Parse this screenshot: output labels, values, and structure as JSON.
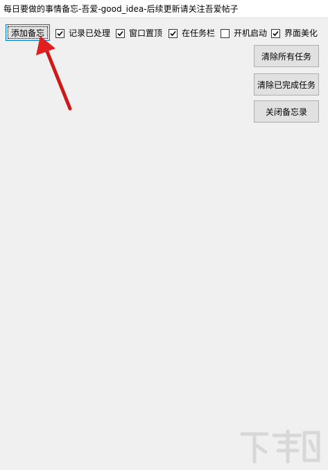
{
  "window": {
    "title": "每日要做的事情备忘-吾爱-good_idea-后续更新请关注吾爱帖子"
  },
  "toolbar": {
    "add_button": "添加备忘",
    "options": [
      {
        "label": "记录已处理",
        "checked": true
      },
      {
        "label": "窗口置顶",
        "checked": true
      },
      {
        "label": "在任务栏",
        "checked": true
      },
      {
        "label": "开机启动",
        "checked": false
      },
      {
        "label": "界面美化",
        "checked": true
      }
    ]
  },
  "actions": {
    "clear_all": "清除所有任务",
    "clear_done": "清除已完成任务",
    "close_memo": "关闭备忘录"
  },
  "colors": {
    "annotation_arrow": "#e02020",
    "focus_border": "#0078d7",
    "window_bg": "#f0f0f0"
  }
}
